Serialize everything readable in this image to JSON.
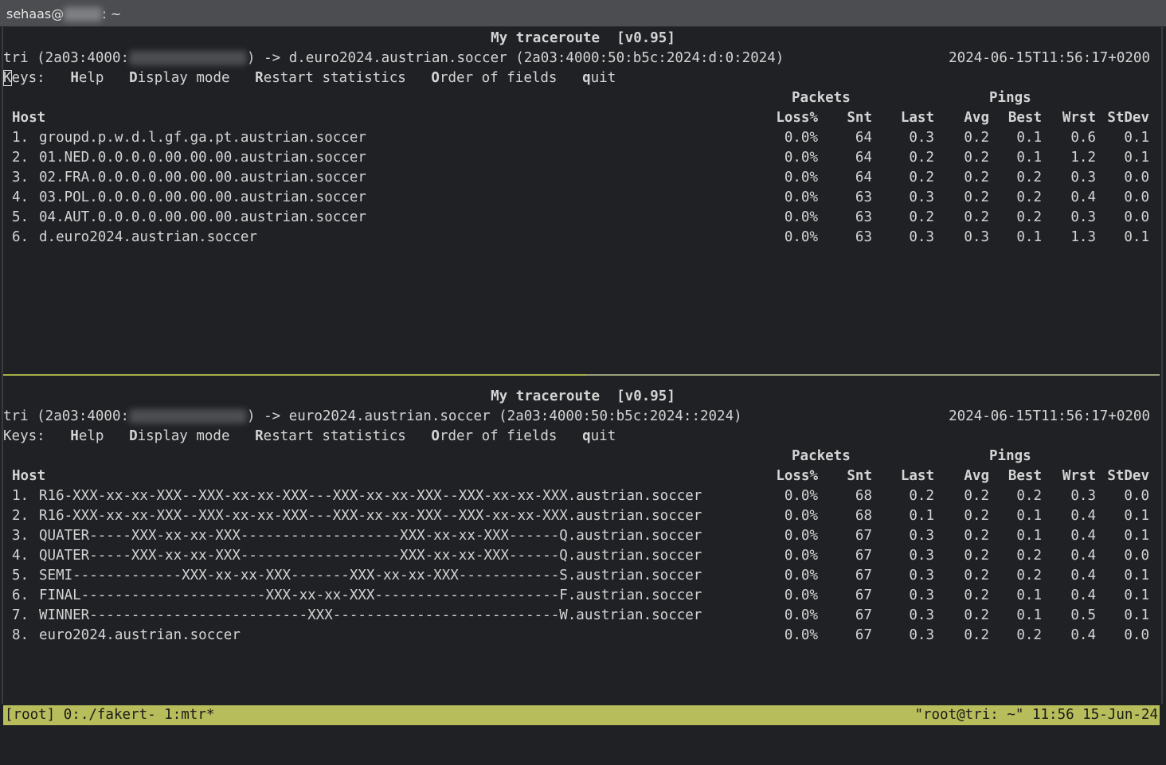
{
  "window": {
    "title_prefix": "sehaas@",
    "title_suffix": ": ~"
  },
  "panes": [
    {
      "title": "My traceroute  [v0.95]",
      "target": {
        "prefix": "tri (2a03:4000:",
        "suffix": ") -> d.euro2024.austrian.soccer (2a03:4000:50:b5c:2024:d:0:2024)",
        "timestamp": "2024-06-15T11:56:17+0200"
      },
      "keys": {
        "label": "Keys:",
        "help": "Help",
        "display": "Display mode",
        "restart": "Restart statistics",
        "order": "Order of fields",
        "quit": "quit"
      },
      "headers": {
        "packets": "Packets",
        "pings": "Pings",
        "host": "Host",
        "loss": "Loss%",
        "snt": "Snt",
        "last": "Last",
        "avg": "Avg",
        "best": "Best",
        "wrst": "Wrst",
        "stdev": "StDev"
      },
      "rows": [
        {
          "n": "1.",
          "host": "groupd.p.w.d.l.gf.ga.pt.austrian.soccer",
          "loss": "0.0%",
          "snt": "64",
          "last": "0.3",
          "avg": "0.2",
          "best": "0.1",
          "wrst": "0.6",
          "stdev": "0.1"
        },
        {
          "n": "2.",
          "host": "01.NED.0.0.0.0.00.00.00.austrian.soccer",
          "loss": "0.0%",
          "snt": "64",
          "last": "0.2",
          "avg": "0.2",
          "best": "0.1",
          "wrst": "1.2",
          "stdev": "0.1"
        },
        {
          "n": "3.",
          "host": "02.FRA.0.0.0.0.00.00.00.austrian.soccer",
          "loss": "0.0%",
          "snt": "64",
          "last": "0.2",
          "avg": "0.2",
          "best": "0.2",
          "wrst": "0.3",
          "stdev": "0.0"
        },
        {
          "n": "4.",
          "host": "03.POL.0.0.0.0.00.00.00.austrian.soccer",
          "loss": "0.0%",
          "snt": "63",
          "last": "0.3",
          "avg": "0.2",
          "best": "0.2",
          "wrst": "0.4",
          "stdev": "0.0"
        },
        {
          "n": "5.",
          "host": "04.AUT.0.0.0.0.00.00.00.austrian.soccer",
          "loss": "0.0%",
          "snt": "63",
          "last": "0.2",
          "avg": "0.2",
          "best": "0.2",
          "wrst": "0.3",
          "stdev": "0.0"
        },
        {
          "n": "6.",
          "host": "d.euro2024.austrian.soccer",
          "loss": "0.0%",
          "snt": "63",
          "last": "0.3",
          "avg": "0.3",
          "best": "0.1",
          "wrst": "1.3",
          "stdev": "0.1"
        }
      ]
    },
    {
      "title": "My traceroute  [v0.95]",
      "target": {
        "prefix": "tri (2a03:4000:",
        "suffix": ") -> euro2024.austrian.soccer (2a03:4000:50:b5c:2024::2024)",
        "timestamp": "2024-06-15T11:56:17+0200"
      },
      "keys": {
        "label": "Keys:",
        "help": "Help",
        "display": "Display mode",
        "restart": "Restart statistics",
        "order": "Order of fields",
        "quit": "quit"
      },
      "headers": {
        "packets": "Packets",
        "pings": "Pings",
        "host": "Host",
        "loss": "Loss%",
        "snt": "Snt",
        "last": "Last",
        "avg": "Avg",
        "best": "Best",
        "wrst": "Wrst",
        "stdev": "StDev"
      },
      "rows": [
        {
          "n": "1.",
          "host": "R16-XXX-xx-xx-XXX--XXX-xx-xx-XXX---XXX-xx-xx-XXX--XXX-xx-xx-XXX.austrian.soccer",
          "loss": "0.0%",
          "snt": "68",
          "last": "0.2",
          "avg": "0.2",
          "best": "0.2",
          "wrst": "0.3",
          "stdev": "0.0"
        },
        {
          "n": "2.",
          "host": "R16-XXX-xx-xx-XXX--XXX-xx-xx-XXX---XXX-xx-xx-XXX--XXX-xx-xx-XXX.austrian.soccer",
          "loss": "0.0%",
          "snt": "68",
          "last": "0.1",
          "avg": "0.2",
          "best": "0.1",
          "wrst": "0.4",
          "stdev": "0.1"
        },
        {
          "n": "3.",
          "host": "QUATER-----XXX-xx-xx-XXX-------------------XXX-xx-xx-XXX------Q.austrian.soccer",
          "loss": "0.0%",
          "snt": "67",
          "last": "0.3",
          "avg": "0.2",
          "best": "0.1",
          "wrst": "0.4",
          "stdev": "0.1"
        },
        {
          "n": "4.",
          "host": "QUATER-----XXX-xx-xx-XXX-------------------XXX-xx-xx-XXX------Q.austrian.soccer",
          "loss": "0.0%",
          "snt": "67",
          "last": "0.3",
          "avg": "0.2",
          "best": "0.2",
          "wrst": "0.4",
          "stdev": "0.0"
        },
        {
          "n": "5.",
          "host": "SEMI-------------XXX-xx-xx-XXX-------XXX-xx-xx-XXX------------S.austrian.soccer",
          "loss": "0.0%",
          "snt": "67",
          "last": "0.3",
          "avg": "0.2",
          "best": "0.2",
          "wrst": "0.4",
          "stdev": "0.1"
        },
        {
          "n": "6.",
          "host": "FINAL----------------------XXX-xx-xx-XXX----------------------F.austrian.soccer",
          "loss": "0.0%",
          "snt": "67",
          "last": "0.3",
          "avg": "0.2",
          "best": "0.1",
          "wrst": "0.4",
          "stdev": "0.1"
        },
        {
          "n": "7.",
          "host": "WINNER--------------------------XXX---------------------------W.austrian.soccer",
          "loss": "0.0%",
          "snt": "67",
          "last": "0.3",
          "avg": "0.2",
          "best": "0.1",
          "wrst": "0.5",
          "stdev": "0.1"
        },
        {
          "n": "8.",
          "host": "euro2024.austrian.soccer",
          "loss": "0.0%",
          "snt": "67",
          "last": "0.3",
          "avg": "0.2",
          "best": "0.2",
          "wrst": "0.4",
          "stdev": "0.0"
        }
      ]
    }
  ],
  "statusbar": {
    "left": "[root] 0:./fakert- 1:mtr*",
    "right": "\"root@tri: ~\" 11:56 15-Jun-24"
  }
}
